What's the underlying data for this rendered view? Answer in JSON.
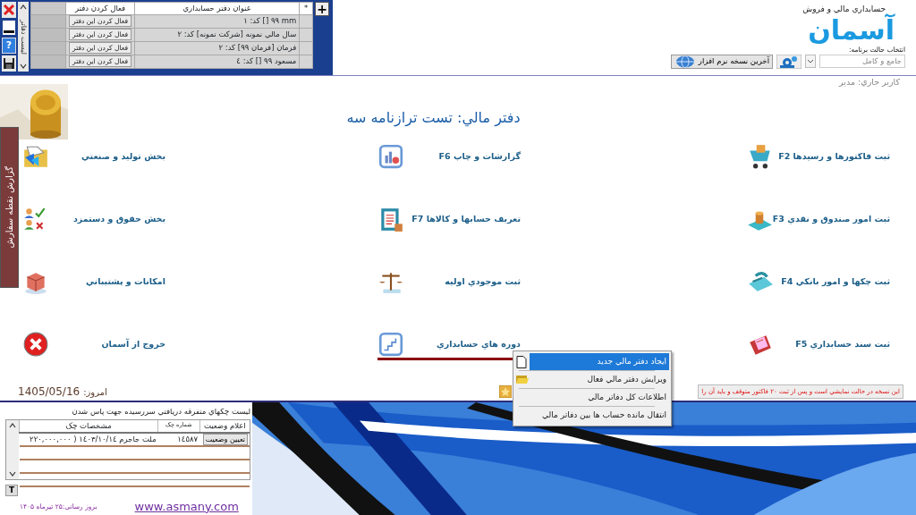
{
  "books_panel": {
    "help_button": "?",
    "tab_label": "ليست دفاتر",
    "add_button": "+",
    "columns": [
      "*",
      "عنوان دفتر حسابداري",
      "فعال كردن دفتر"
    ],
    "rows": [
      {
        "title": "mm ٩٩ []  كد: ١",
        "action": "فعال كردن اين دفتر"
      },
      {
        "title": "سال مالي نمونه [شركت نمونه]  كد: ٢",
        "action": "فعال كردن اين دفتر"
      },
      {
        "title": "فرمان [فرمان ٩٩]  كد: ٢",
        "action": "فعال كردن اين دفتر"
      },
      {
        "title": "مسعود ٩٩ []  كد: ٤",
        "action": "فعال كردن اين دفتر"
      }
    ]
  },
  "app_header": {
    "subtitle": "حسابداري مالي و فروش",
    "logo": "آسمان",
    "mode_label": "انتخاب حالت برنامه:",
    "mode_value": "جامع و كامل",
    "update_button": "آخرين نسخه نرم افزار"
  },
  "current_user": "كاربر جاري: مدير",
  "side_tab": "گزارش نقطه سفارش",
  "title": "دفتر مالي: تست ترازنامه سه",
  "modules": [
    {
      "label": "ثبت فاكتورها و رسيدها F2",
      "selected": false
    },
    {
      "label": "گزارشات و چاپ  F6",
      "selected": false
    },
    {
      "label": "بخش توليد و صنعتي",
      "selected": false
    },
    {
      "label": "ثبت امور صندوق و نقدي F3",
      "selected": false
    },
    {
      "label": "تعريف حسابها و كالاها  F7",
      "selected": false
    },
    {
      "label": "بخش حقوق و دستمزد",
      "selected": false
    },
    {
      "label": "ثبت چكها و امور بانكي F4",
      "selected": false
    },
    {
      "label": "ثبت موجودي اوليه",
      "selected": false
    },
    {
      "label": "امكانات و پشتيباني",
      "selected": false
    },
    {
      "label": "ثبت سند حسابداري  F5",
      "selected": false
    },
    {
      "label": "دوره هاي حسابداري",
      "selected": true
    },
    {
      "label": "خروج از آسمان",
      "selected": false
    }
  ],
  "context_menu": [
    {
      "label": "ايجاد دفتر مالي جديد",
      "selected": true
    },
    {
      "label": "ويرايش دفتر مالي فعال",
      "selected": false
    },
    {
      "label": "اطلاعات كل دفاتر مالي",
      "selected": false
    },
    {
      "label": "انتقال مانده حساب ها بين دفاتر مالي",
      "selected": false
    }
  ],
  "today": {
    "label": "امروز:",
    "date": "1405/05/16"
  },
  "notice": "اين نسخه در حالت نمايشي است و پس از ثبت ۲۰ فاكتور متوقف و بايد آن را",
  "check_list": {
    "title": "ليست چكهاي متفرقه دريافتي سررسيده جهت پاس شدن",
    "columns": [
      "اعلام وضعيت",
      "شماره چک",
      "مشخصات چک"
    ],
    "rows": [
      {
        "action": "تعيين وضعيت",
        "number": "١٤٥٨٧",
        "details": "ملت جاجرم ١٤٠٣/١٠/١٤  ( ٢٢٠,٠٠٠,٠٠٠"
      }
    ],
    "toggle_button": "T"
  },
  "footer": {
    "updated": "بروز رسانی:۲۵ تیرماه ۱۴۰۵",
    "website": "www.asmany.com"
  }
}
